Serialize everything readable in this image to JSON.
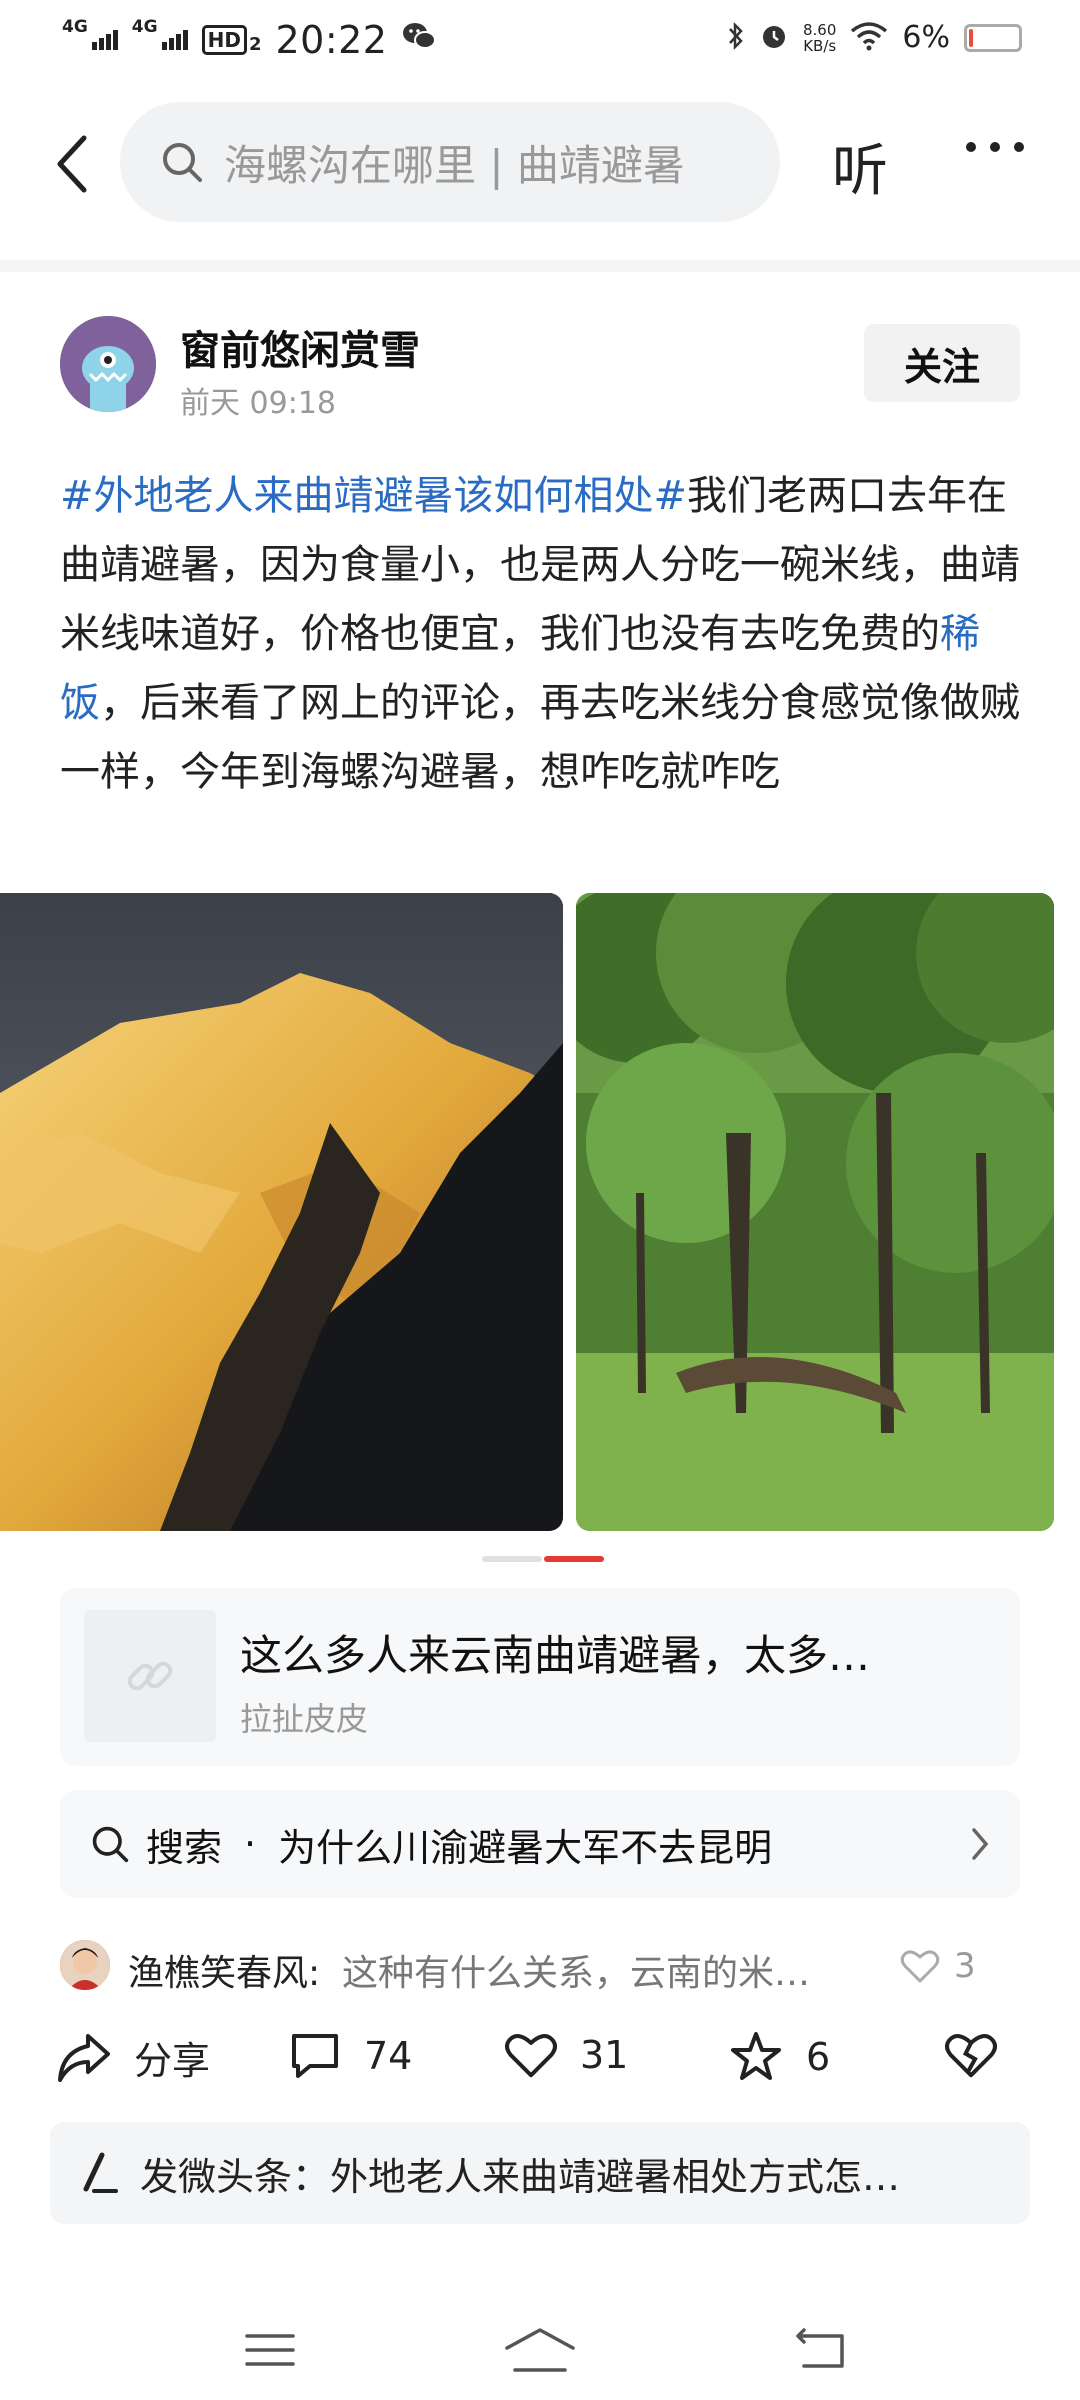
{
  "status_bar": {
    "network_1": "4G",
    "network_2": "4G",
    "hd": "HD",
    "hd_sub": "2",
    "time": "20:22",
    "net_speed_value": "8.60",
    "net_speed_unit": "KB/s",
    "battery_percent": "6%",
    "battery_level": 0.06
  },
  "nav": {
    "search_placeholder": "海螺沟在哪里 | 曲靖避暑",
    "listen_label": "听"
  },
  "post": {
    "author": "窗前悠闲赏雪",
    "time": "前天  09:18",
    "follow_label": "关注",
    "body_parts": {
      "hashtag": "#外地老人来曲靖避暑该如何相处#",
      "text1": "我们老两口去年在曲靖避暑，因为食量小，也是两人分吃一碗米线，曲靖米线味道好，价格也便宜，我们也没有去吃免费的",
      "link": "稀饭",
      "text2": "，后来看了网上的评论，再去吃米线分食感觉像做贼一样，今年到海螺沟避暑，想咋吃就咋吃"
    }
  },
  "related": {
    "title": "这么多人来云南曲靖避暑，太多…",
    "source": "拉扯皮皮"
  },
  "search_suggestion": {
    "label": "搜索",
    "separator": "·",
    "query": "为什么川渝避暑大军不去昆明"
  },
  "comment_preview": {
    "name": "渔樵笑春风:",
    "text": "这种有什么关系，云南的米…",
    "likes": "3"
  },
  "actions": {
    "share_label": "分享",
    "comment_count": "74",
    "like_count": "31",
    "favorite_count": "6"
  },
  "publish": {
    "label": "发微头条：外地老人来曲靖避暑相处方式怎…"
  },
  "colors": {
    "hashtag_blue": "#2a6bc3",
    "pager_active": "#e53935",
    "battery_low": "#e74c3c"
  }
}
